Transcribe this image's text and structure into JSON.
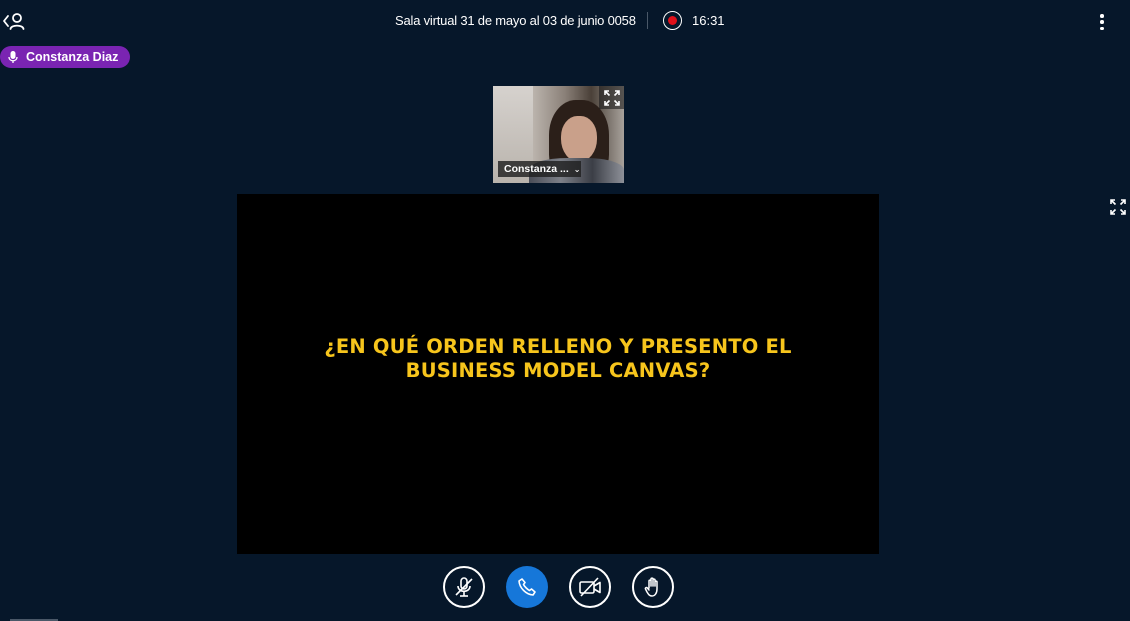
{
  "header": {
    "room_title": "Sala virtual 31 de mayo al 03 de junio 0058",
    "recording_time": "16:31",
    "recording_color": "#e0101a"
  },
  "talking_indicator": {
    "name": "Constanza Diaz",
    "color": "#7a24b2"
  },
  "webcam": {
    "user_label": "Constanza ...",
    "dropdown_icon": "chevron-down-icon",
    "expand_icon": "fullscreen-icon"
  },
  "presentation": {
    "line1": "¿EN QUÉ ORDEN RELLENO Y PRESENTO EL",
    "line2": "BUSINESS MODEL CANVAS?",
    "text_color": "#f7c51c"
  },
  "controls": {
    "mic": "mic-muted-icon",
    "audio": "phone-icon",
    "camera": "camera-off-icon",
    "hand": "raise-hand-icon",
    "accent": "#1677d9"
  },
  "colors": {
    "background": "#06172a"
  }
}
